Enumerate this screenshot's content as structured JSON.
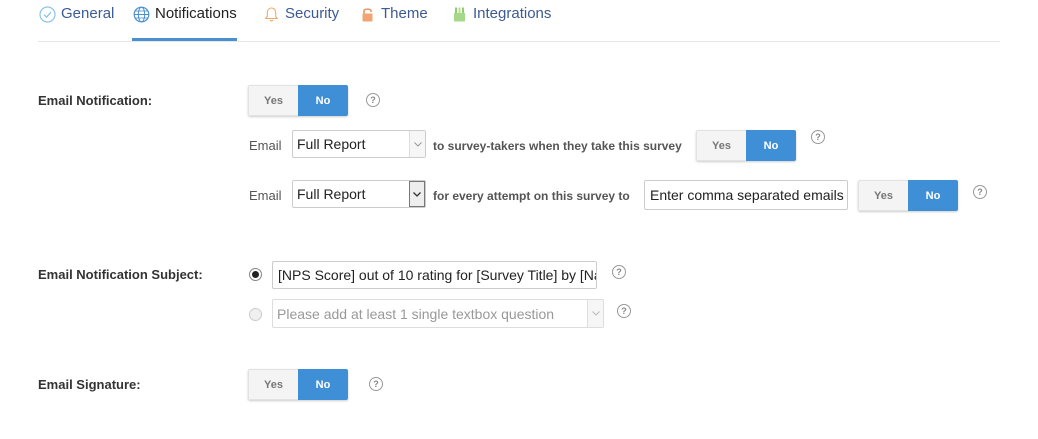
{
  "tabs": {
    "general": "General",
    "notifications": "Notifications",
    "security": "Security",
    "theme": "Theme",
    "integrations": "Integrations"
  },
  "colors": {
    "accent": "#3f8fd6",
    "link": "#3c5a93"
  },
  "email_notification": {
    "label": "Email Notification:",
    "toggle": {
      "yes": "Yes",
      "no": "No",
      "selected": "No"
    },
    "row1": {
      "prefix": "Email",
      "select_value": "Full Report",
      "suffix": "to survey-takers when they take this survey",
      "toggle": {
        "yes": "Yes",
        "no": "No",
        "selected": "No"
      }
    },
    "row2": {
      "prefix": "Email",
      "select_value": "Full Report",
      "suffix": "for every attempt on this survey to",
      "input_value": "Enter comma separated emails",
      "toggle": {
        "yes": "Yes",
        "no": "No",
        "selected": "No"
      }
    }
  },
  "email_subject": {
    "label": "Email Notification Subject:",
    "subject_value": "[NPS Score] out of 10 rating for [Survey Title] by [Na",
    "question_select_placeholder": "Please add at least 1 single textbox question"
  },
  "email_signature": {
    "label": "Email Signature:",
    "toggle": {
      "yes": "Yes",
      "no": "No",
      "selected": "No"
    }
  },
  "help_glyph": "?"
}
